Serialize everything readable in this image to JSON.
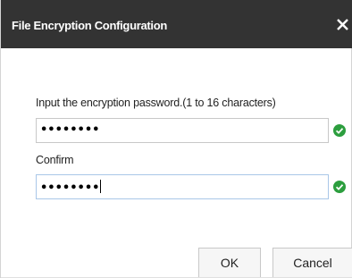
{
  "dialog": {
    "title": "File Encryption Configuration",
    "password_label": "Input the encryption password.(1 to 16 characters)",
    "password_value": "••••••••",
    "confirm_label": "Confirm",
    "confirm_value": "••••••••",
    "ok_label": "OK",
    "cancel_label": "Cancel"
  },
  "icons": {
    "close": "close-icon",
    "valid": "check-circle-icon"
  },
  "colors": {
    "titlebar": "#333333",
    "valid_green": "#2c9e3e",
    "focus_border": "#a9c7e8"
  }
}
